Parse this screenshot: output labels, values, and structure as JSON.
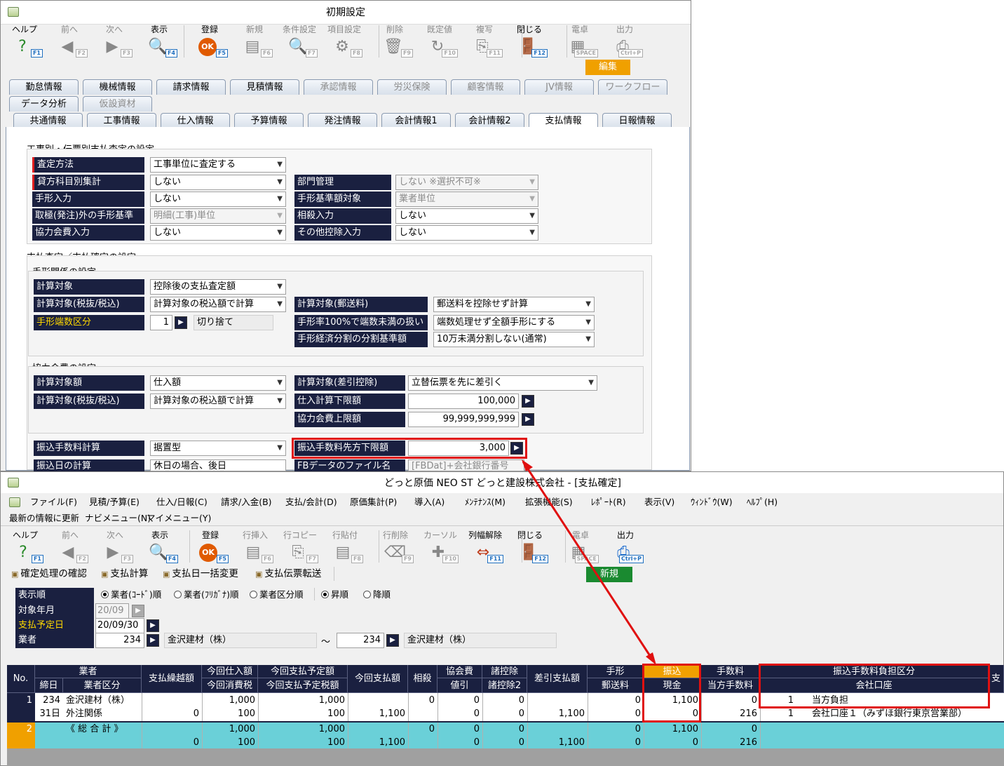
{
  "w1": {
    "title": "初期設定",
    "toolbar": [
      {
        "label": "ヘルプ",
        "fkey": "F1",
        "glyph": "?",
        "color": "#2a8a2a",
        "dis": false
      },
      {
        "label": "前へ",
        "fkey": "F2",
        "glyph": "◀",
        "color": "#888",
        "dis": true
      },
      {
        "label": "次へ",
        "fkey": "F3",
        "glyph": "▶",
        "color": "#888",
        "dis": true
      },
      {
        "label": "表示",
        "fkey": "F4",
        "glyph": "🔍",
        "color": "#1a6acf",
        "dis": false
      },
      {
        "label": "登録",
        "fkey": "F5",
        "glyph": "OK",
        "color": "#e05a00",
        "dis": false
      },
      {
        "label": "新規",
        "fkey": "F6",
        "glyph": "▤",
        "color": "#888",
        "dis": true
      },
      {
        "label": "条件設定",
        "fkey": "F7",
        "glyph": "🔍",
        "color": "#888",
        "dis": true
      },
      {
        "label": "項目設定",
        "fkey": "F8",
        "glyph": "⚙",
        "color": "#888",
        "dis": true
      },
      {
        "label": "削除",
        "fkey": "F9",
        "glyph": "🗑",
        "color": "#888",
        "dis": true
      },
      {
        "label": "既定値",
        "fkey": "F10",
        "glyph": "↻",
        "color": "#888",
        "dis": true
      },
      {
        "label": "複写",
        "fkey": "F11",
        "glyph": "⎘",
        "color": "#888",
        "dis": true
      },
      {
        "label": "閉じる",
        "fkey": "F12",
        "glyph": "🚪",
        "color": "#a05a10",
        "dis": false
      },
      {
        "label": "電卓",
        "fkey": "SPACE",
        "glyph": "▦",
        "color": "#888",
        "dis": true
      },
      {
        "label": "出力",
        "fkey": "Ctrl+P",
        "glyph": "⎙",
        "color": "#888",
        "dis": true
      }
    ],
    "edit_label": "編集",
    "tabs1": [
      "勤怠情報",
      "機械情報",
      "請求情報",
      "見積情報",
      "承認情報",
      "労災保険",
      "顧客情報",
      "JV情報",
      "ワークフロー"
    ],
    "tabs2": [
      "データ分析",
      "仮設資材"
    ],
    "tabs3": [
      "共通情報",
      "工事情報",
      "仕入情報",
      "予算情報",
      "発注情報",
      "会計情報1",
      "会計情報2",
      "支払情報",
      "日報情報"
    ],
    "s1": "工事別・伝票別支払査定の設定",
    "s1_rows": [
      {
        "l": "査定方法",
        "v": "工事単位に査定する"
      },
      {
        "l": "貸方科目別集計",
        "v": "しない"
      },
      {
        "l": "手形入力",
        "v": "しない"
      },
      {
        "l": "取極(発注)外の手形基準",
        "v": "明細(工事)単位"
      },
      {
        "l": "協力会費入力",
        "v": "しない"
      }
    ],
    "s1_right": [
      {
        "l": "部門管理",
        "v": "しない ※選択不可※"
      },
      {
        "l": "手形基準額対象",
        "v": "業者単位"
      },
      {
        "l": "相殺入力",
        "v": "しない"
      },
      {
        "l": "その他控除入力",
        "v": "しない"
      }
    ],
    "s2": "支払査定／支払確定の設定",
    "s2a": "手形関係の設定",
    "tg": {
      "l1": "計算対象",
      "v1": "控除後の支払査定額",
      "l2": "計算対象(税抜/税込)",
      "v2": "計算対象の税込額で計算",
      "l3": "手形端数区分",
      "v3n": "1",
      "v3t": "切り捨て",
      "r1l": "計算対象(郵送料)",
      "r1v": "郵送料を控除せず計算",
      "r2l": "手形率100%で端数未満の扱い",
      "r2v": "端数処理せず全額手形にする",
      "r3l": "手形経済分割の分割基準額",
      "r3v": "10万未満分割しない(通常)"
    },
    "s2b": "協力会費の設定",
    "kg": {
      "l1": "計算対象額",
      "v1": "仕入額",
      "l2": "計算対象(税抜/税込)",
      "v2": "計算対象の税込額で計算",
      "r1l": "計算対象(差引控除)",
      "r1v": "立替伝票を先に差引く",
      "r2l": "仕入計算下限額",
      "r2v": "100,000",
      "r3l": "協力会費上限額",
      "r3v": "99,999,999,999"
    },
    "fee": {
      "l": "振込手数料計算",
      "v": "据置型",
      "rl": "振込手数料先方下限額",
      "rv": "3,000"
    },
    "day": {
      "l": "振込日の計算",
      "v": "休日の場合、後日",
      "rl": "FBデータのファイル名",
      "rv": "[FBDat]+会社銀行番号"
    }
  },
  "w2": {
    "title": "どっと原価 NEO ST  どっと建設株式会社 - [支払確定]",
    "menu": [
      "ファイル(F)",
      "見積/予算(E)",
      "仕入/日報(C)",
      "請求/入金(B)",
      "支払/会計(D)",
      "原価集計(P)",
      "導入(A)",
      "ﾒﾝﾃﾅﾝｽ(M)",
      "拡張機能(S)",
      "ﾚﾎﾟｰﾄ(R)",
      "表示(V)",
      "ｳｨﾝﾄﾞｳ(W)",
      "ﾍﾙﾌﾟ(H)"
    ],
    "menu2": [
      "最新の情報に更新",
      "ナビメニュー(N)",
      "マイメニュー(Y)"
    ],
    "toolbar": [
      {
        "label": "ヘルプ",
        "fkey": "F1",
        "glyph": "?",
        "color": "#2a8a2a",
        "dis": false
      },
      {
        "label": "前へ",
        "fkey": "F2",
        "glyph": "◀",
        "color": "#888",
        "dis": true
      },
      {
        "label": "次へ",
        "fkey": "F3",
        "glyph": "▶",
        "color": "#888",
        "dis": true
      },
      {
        "label": "表示",
        "fkey": "F4",
        "glyph": "🔍",
        "color": "#1a6acf",
        "dis": false
      },
      {
        "label": "登録",
        "fkey": "F5",
        "glyph": "OK",
        "color": "#e05a00",
        "dis": false
      },
      {
        "label": "行挿入",
        "fkey": "F6",
        "glyph": "▤",
        "color": "#888",
        "dis": true
      },
      {
        "label": "行コピー",
        "fkey": "F7",
        "glyph": "⎘",
        "color": "#888",
        "dis": true
      },
      {
        "label": "行貼付",
        "fkey": "F8",
        "glyph": "▤",
        "color": "#888",
        "dis": true
      },
      {
        "label": "行削除",
        "fkey": "F9",
        "glyph": "⌫",
        "color": "#888",
        "dis": true
      },
      {
        "label": "カーソル",
        "fkey": "F10",
        "glyph": "✚",
        "color": "#888",
        "dis": true
      },
      {
        "label": "列幅解除",
        "fkey": "F11",
        "glyph": "⇔",
        "color": "#c04020",
        "dis": false
      },
      {
        "label": "閉じる",
        "fkey": "F12",
        "glyph": "🚪",
        "color": "#a05a10",
        "dis": false
      },
      {
        "label": "電卓",
        "fkey": "SPACE",
        "glyph": "▦",
        "color": "#888",
        "dis": true
      },
      {
        "label": "出力",
        "fkey": "Ctrl+P",
        "glyph": "⎙",
        "color": "#1a6acf",
        "dis": false
      }
    ],
    "actions": [
      "確定処理の確認",
      "支払計算",
      "支払日一括変更",
      "支払伝票転送"
    ],
    "new_label": "新規",
    "filters": {
      "order_l": "表示順",
      "radios": [
        "業者(ｺｰﾄﾞ)順",
        "業者(ﾌﾘｶﾞﾅ)順",
        "業者区分順"
      ],
      "sort": [
        "昇順",
        "降順"
      ],
      "ym_l": "対象年月",
      "ym": "20/09",
      "pay_l": "支払予定日",
      "pay": "20/09/30",
      "vend_l": "業者",
      "v_from": "234",
      "v_from_name": "金沢建材（株）",
      "tilde": "～",
      "v_to": "234",
      "v_to_name": "金沢建材（株）"
    },
    "headers": {
      "no": "No.",
      "vendor": "業者",
      "close": "締日",
      "vtype": "業者区分",
      "carry": "支払繰越額",
      "pur": "今回仕入額",
      "tax": "今回消費税",
      "plan": "今回支払予定額",
      "plantax": "今回支払予定税額",
      "pay": "今回支払額",
      "offset": "相殺",
      "assoc": "協会費",
      "disc": "値引",
      "ded": "諸控除",
      "ded2": "諸控除2",
      "net": "差引支払額",
      "note": "手形",
      "post": "郵送料",
      "tr": "振込",
      "cash": "現金",
      "fee": "手数料",
      "ourfee": "当方手数料",
      "feediv": "振込手数料負担区分",
      "acct": "会社口座",
      "pay2": "支"
    },
    "rows": [
      {
        "no": "1",
        "code": "234",
        "name": "金沢建材（株）",
        "close": "31日",
        "vtype": "外注関係",
        "carry": "0",
        "pur": "1,000",
        "tax": "100",
        "plan": "1,000",
        "plantax": "100",
        "pay": "1,100",
        "offset": "0",
        "assoc": "0",
        "disc": "0",
        "ded": "0",
        "ded2": "0",
        "net": "1,100",
        "note": "0",
        "post": "0",
        "tr": "1,100",
        "cash": "0",
        "fee": "0",
        "ourfee": "216",
        "fd_n": "1",
        "fd": "当方負担",
        "acct_n": "1",
        "acct": "会社口座１（みずほ銀行東京営業部）"
      },
      {
        "no": "2",
        "name": "《 総 合 計 》",
        "carry": "0",
        "pur": "1,000",
        "tax": "100",
        "plan": "1,000",
        "plantax": "100",
        "pay": "1,100",
        "offset": "0",
        "assoc": "0",
        "disc": "0",
        "ded": "0",
        "ded2": "0",
        "net": "1,100",
        "note": "0",
        "post": "0",
        "tr": "1,100",
        "cash": "0",
        "fee": "0",
        "ourfee": "216"
      }
    ]
  },
  "colors": {
    "navy": "#1a2040",
    "orange": "#f0a000",
    "highlight": "#e01010",
    "total": "#6ad0d8"
  }
}
